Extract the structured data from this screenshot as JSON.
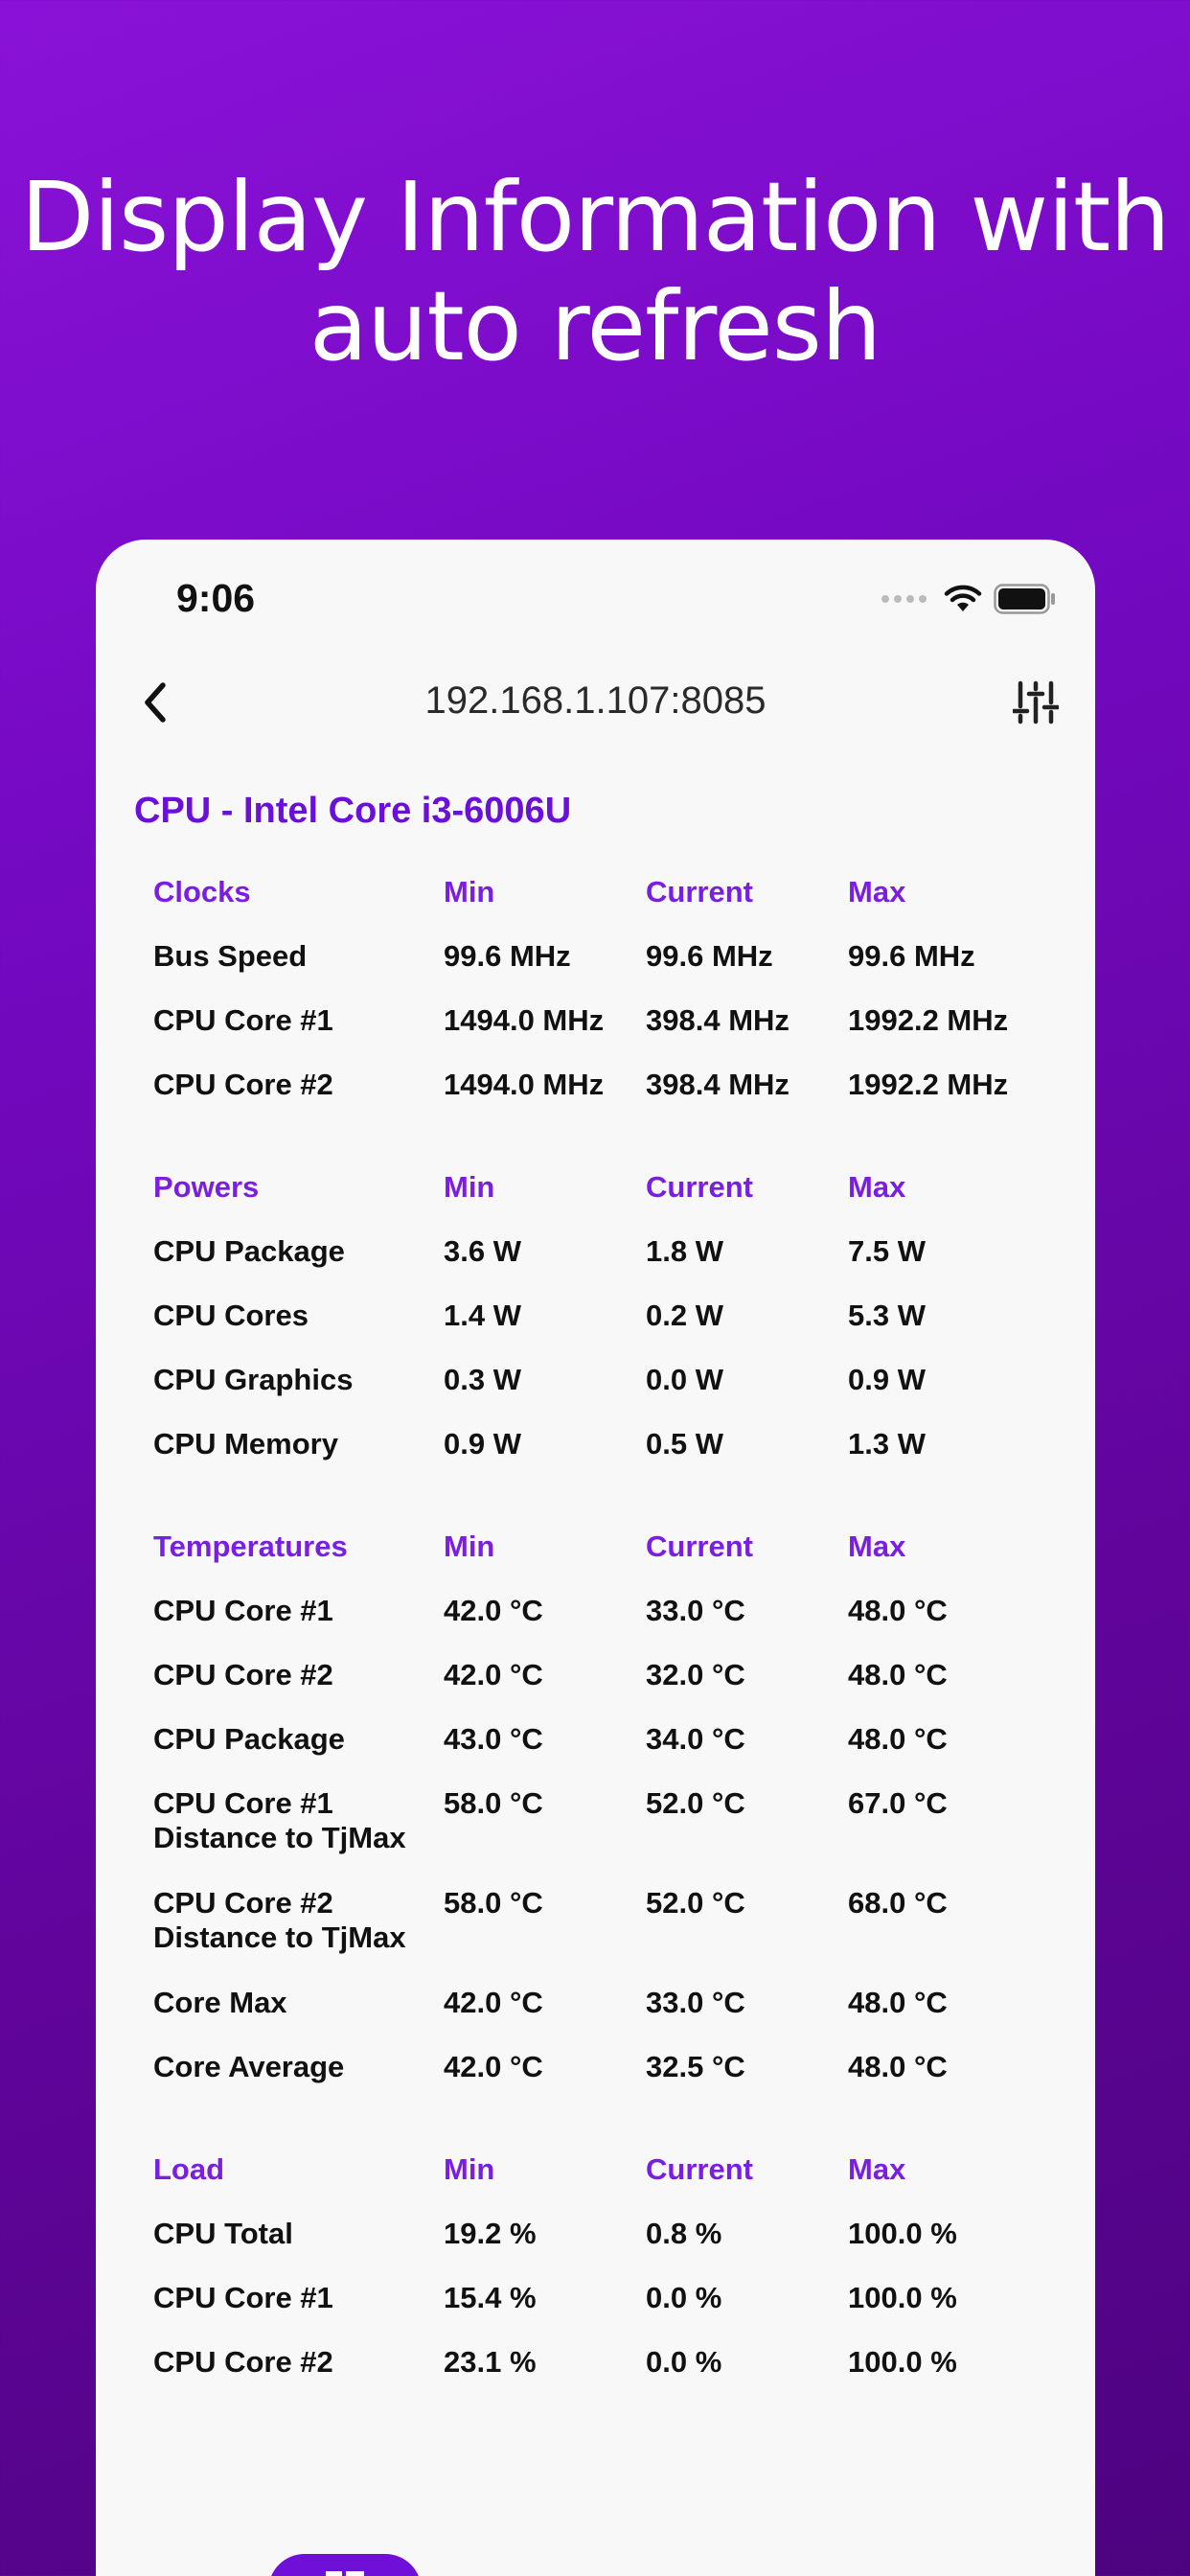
{
  "headline": {
    "line1": "Display Information with",
    "line2": "auto refresh"
  },
  "status_bar": {
    "time": "9:06",
    "icons": [
      "signal-dots-icon",
      "wifi-icon",
      "battery-icon"
    ]
  },
  "nav": {
    "title": "192.168.1.107:8085",
    "back_icon": "chevron-left-icon",
    "settings_icon": "sliders-icon"
  },
  "section_title": "CPU - Intel Core i3-6006U",
  "groups": [
    {
      "header": [
        "Clocks",
        "Min",
        "Current",
        "Max"
      ],
      "rows": [
        [
          "Bus Speed",
          "99.6 MHz",
          "99.6 MHz",
          "99.6 MHz"
        ],
        [
          "CPU Core #1",
          "1494.0 MHz",
          "398.4 MHz",
          "1992.2 MHz"
        ],
        [
          "CPU Core #2",
          "1494.0 MHz",
          "398.4 MHz",
          "1992.2 MHz"
        ]
      ]
    },
    {
      "header": [
        "Powers",
        "Min",
        "Current",
        "Max"
      ],
      "rows": [
        [
          "CPU Package",
          "3.6 W",
          "1.8 W",
          "7.5 W"
        ],
        [
          "CPU Cores",
          "1.4 W",
          "0.2 W",
          "5.3 W"
        ],
        [
          "CPU Graphics",
          "0.3 W",
          "0.0 W",
          "0.9 W"
        ],
        [
          "CPU Memory",
          "0.9 W",
          "0.5 W",
          "1.3 W"
        ]
      ]
    },
    {
      "header": [
        "Temperatures",
        "Min",
        "Current",
        "Max"
      ],
      "rows": [
        [
          "CPU Core #1",
          "42.0 °C",
          "33.0 °C",
          "48.0 °C"
        ],
        [
          "CPU Core #2",
          "42.0 °C",
          "32.0 °C",
          "48.0 °C"
        ],
        [
          "CPU Package",
          "43.0 °C",
          "34.0 °C",
          "48.0 °C"
        ],
        [
          "CPU Core #1\nDistance to TjMax",
          "58.0 °C",
          "52.0 °C",
          "67.0 °C"
        ],
        [
          "CPU Core #2\nDistance to TjMax",
          "58.0 °C",
          "52.0 °C",
          "68.0 °C"
        ],
        [
          "Core Max",
          "42.0 °C",
          "33.0 °C",
          "48.0 °C"
        ],
        [
          "Core Average",
          "42.0 °C",
          "32.5 °C",
          "48.0 °C"
        ]
      ]
    },
    {
      "header": [
        "Load",
        "Min",
        "Current",
        "Max"
      ],
      "rows": [
        [
          "CPU Total",
          "19.2 %",
          "0.8 %",
          "100.0 %"
        ],
        [
          "CPU Core #1",
          "15.4 %",
          "0.0 %",
          "100.0 %"
        ],
        [
          "CPU Core #2",
          "23.1 %",
          "0.0 %",
          "100.0 %"
        ]
      ]
    }
  ],
  "tabbar": {
    "dashboard_icon": "dashboard-icon",
    "more_icon": "more-dots-icon"
  },
  "colors": {
    "accent": "#6f0fd8",
    "background_gradient_start": "#8a12d8",
    "background_gradient_end": "#4d0380"
  }
}
